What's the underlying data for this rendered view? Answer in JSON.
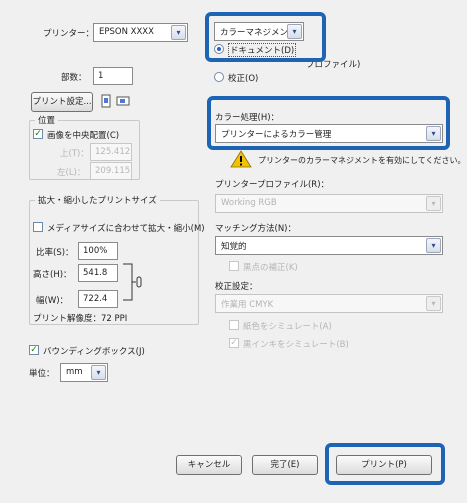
{
  "left": {
    "printer_label": "プリンター：",
    "printer_value": "EPSON XXXX",
    "copies_label": "部数：",
    "copies_value": "1",
    "print_setup_button": "プリント設定...",
    "position_group": "位置",
    "center_image_label": "画像を中央配置(C)",
    "top_label": "上(T)：",
    "top_value": "125.412",
    "left_label": "左(L)：",
    "left_value": "209.115",
    "scaled_group": "拡大・縮小したプリントサイズ",
    "fit_media_label": "メディアサイズに合わせて拡大・縮小(M)",
    "scale_label": "比率(S)：",
    "scale_value": "100%",
    "height_label": "高さ(H)：",
    "height_value": "541.8",
    "width_label": "幅(W)：",
    "width_value": "722.4",
    "resolution_text": "プリント解像度：72 PPI",
    "bounding_box_label": "バウンディングボックス(J)",
    "unit_label": "単位：",
    "unit_value": "mm"
  },
  "right": {
    "mode_combo": "カラーマネジメント",
    "document_radio": "ドキュメント(D)",
    "profile_text": "プロファイル)",
    "proof_radio": "校正(O)",
    "color_handling_label": "カラー処理(H)：",
    "color_handling_value": "プリンターによるカラー管理",
    "warning_text": "プリンターのカラーマネジメントを有効にしてください。",
    "printer_profile_label": "プリンタープロファイル(R)：",
    "printer_profile_value": "Working RGB",
    "rendering_intent_label": "マッチング方法(N)：",
    "rendering_intent_value": "知覚的",
    "bpc_label": "黒点の補正(K)",
    "proof_setup_label": "校正設定：",
    "proof_setup_value": "作業用 CMYK",
    "paper_color_label": "紙色をシミュレート(A)",
    "black_ink_label": "黒インキをシミュレート(B)"
  },
  "buttons": {
    "cancel": "キャンセル",
    "done": "完了(E)",
    "print": "プリント(P)"
  },
  "colors": {
    "highlight": "#1e64b4",
    "warning": "#f2c200"
  }
}
